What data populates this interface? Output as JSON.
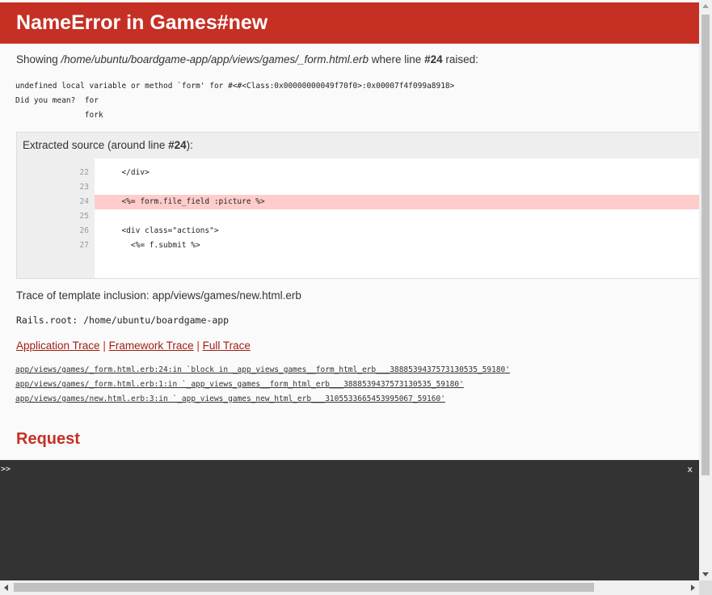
{
  "header": {
    "title": "NameError in Games#new"
  },
  "showing": {
    "prefix": "Showing ",
    "path": "/home/ubuntu/boardgame-app/app/views/games/_form.html.erb",
    "middle": " where line ",
    "line": "#24",
    "suffix": " raised:"
  },
  "error_message": "undefined local variable or method `form' for #<#<Class:0x00000000049f70f0>:0x00007f4f099a8918>\nDid you mean?  for\n               fork",
  "source": {
    "title_prefix": "Extracted source (around line ",
    "title_line": "#24",
    "title_suffix": "):",
    "lines": [
      {
        "num": "22",
        "code": "  </div>"
      },
      {
        "num": "23",
        "code": ""
      },
      {
        "num": "24",
        "code": "  <%= form.file_field :picture %>"
      },
      {
        "num": "25",
        "code": ""
      },
      {
        "num": "26",
        "code": "  <div class=\"actions\">"
      },
      {
        "num": "27",
        "code": "    <%= f.submit %>"
      }
    ]
  },
  "template_trace": "Trace of template inclusion: app/views/games/new.html.erb",
  "rails_root": "Rails.root: /home/ubuntu/boardgame-app",
  "trace_links": {
    "application": "Application Trace",
    "framework": "Framework Trace",
    "full": "Full Trace",
    "separator": " | "
  },
  "trace_lines": [
    "app/views/games/_form.html.erb:24:in `block in _app_views_games__form_html_erb___3888539437573130535_59180'",
    "app/views/games/_form.html.erb:1:in `_app_views_games__form_html_erb___3888539437573130535_59180'",
    "app/views/games/new.html.erb:3:in `_app_views_games_new_html_erb___3105533665453995067_59160'"
  ],
  "request_heading": "Request",
  "console": {
    "prompt": ">>",
    "close": "x"
  },
  "colors": {
    "accent": "#c52f24",
    "highlight": "#ffcccc",
    "console_bg": "#333333"
  }
}
